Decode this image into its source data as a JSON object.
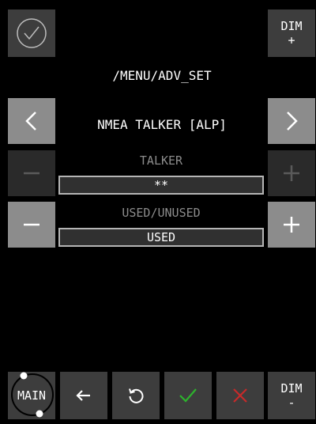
{
  "top_left_icon": "check-circle-icon",
  "dim_plus": {
    "label": "DIM\n+"
  },
  "dim_minus": {
    "label": "DIM\n-"
  },
  "path": "/MENU/ADV_SET",
  "menu_title": "NMEA TALKER [ALP]",
  "field1": {
    "label": "TALKER",
    "value": "**",
    "state": "disabled"
  },
  "field2": {
    "label": "USED/UNUSED",
    "value": "USED",
    "state": "active"
  },
  "bottom": {
    "main_label": "MAIN",
    "icons": [
      "back-arrow-icon",
      "refresh-icon",
      "confirm-check-icon",
      "cancel-x-icon"
    ]
  },
  "colors": {
    "accent_green": "#2db32d",
    "cancel_red": "#c62a2a",
    "button_dark": "#3d3d3d",
    "button_light": "#8c8c8c"
  }
}
